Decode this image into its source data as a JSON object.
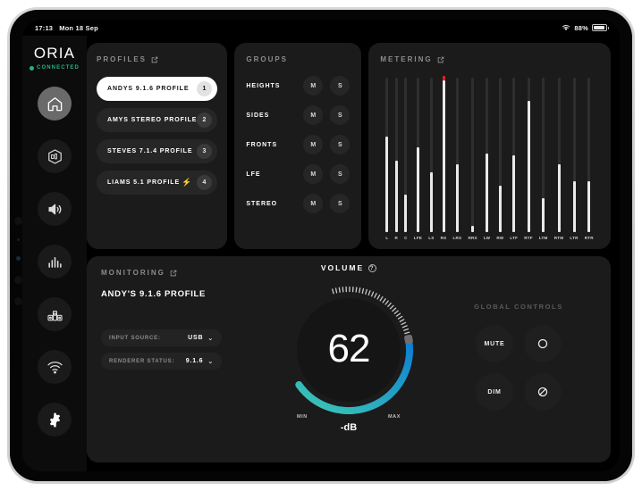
{
  "status_bar": {
    "time": "17:13",
    "date": "Mon 18 Sep",
    "battery_percent": "88%",
    "wifi_icon": "wifi-icon"
  },
  "brand": {
    "name": "ORIA",
    "connection_status": "CONNECTED",
    "status_color": "#24b47e"
  },
  "sidebar": {
    "items": [
      {
        "name": "home",
        "icon": "home-icon",
        "active": true
      },
      {
        "name": "spatial",
        "icon": "cube-icon",
        "active": false
      },
      {
        "name": "audio",
        "icon": "speaker-icon",
        "active": false
      },
      {
        "name": "levels",
        "icon": "bars-icon",
        "active": false
      },
      {
        "name": "monitors",
        "icon": "speakers-icon",
        "active": false
      },
      {
        "name": "network",
        "icon": "wifi-icon",
        "active": false
      },
      {
        "name": "settings",
        "icon": "gear-icon",
        "active": false
      }
    ]
  },
  "profiles": {
    "title": "PROFILES",
    "items": [
      {
        "label": "ANDYS 9.1.6 PROFILE",
        "badge": "1",
        "selected": true,
        "bolt": false
      },
      {
        "label": "AMYS STEREO PROFILE",
        "badge": "2",
        "selected": false,
        "bolt": false
      },
      {
        "label": "STEVES 7.1.4 PROFILE",
        "badge": "3",
        "selected": false,
        "bolt": false
      },
      {
        "label": "LIAMS 5.1 PROFILE",
        "badge": "4",
        "selected": false,
        "bolt": true
      }
    ]
  },
  "groups": {
    "title": "GROUPS",
    "mute_label": "M",
    "solo_label": "S",
    "items": [
      {
        "label": "HEIGHTS"
      },
      {
        "label": "SIDES"
      },
      {
        "label": "FRONTS"
      },
      {
        "label": "LFE"
      },
      {
        "label": "STEREO"
      }
    ]
  },
  "metering": {
    "title": "METERING"
  },
  "chart_data": {
    "type": "bar",
    "title": "METERING",
    "xlabel": "",
    "ylabel": "",
    "ylim": [
      0,
      100
    ],
    "grid": false,
    "categories": [
      "L",
      "R",
      "C",
      "LFE",
      "LS",
      "RS",
      "LRS",
      "RRS",
      "LW",
      "RW",
      "LTF",
      "RTF",
      "LTM",
      "RTM",
      "LTR",
      "RTR"
    ],
    "values": [
      62,
      46,
      24,
      55,
      39,
      98,
      44,
      4,
      51,
      30,
      50,
      85,
      22,
      44,
      33,
      33
    ],
    "peak_channel": "RS",
    "peak_color": "#e02020",
    "bar_color": "#e9e9e9",
    "track_color": "#2e2e2e"
  },
  "monitoring": {
    "title": "MONITORING",
    "profile_name": "ANDY'S 9.1.6 PROFILE",
    "fields": [
      {
        "key": "INPUT SOURCE:",
        "value": "USB"
      },
      {
        "key": "RENDERER STATUS:",
        "value": "9.1.6"
      }
    ]
  },
  "volume": {
    "title": "VOLUME",
    "value": "62",
    "unit": "-dB",
    "min_label": "MIN",
    "max_label": "MAX",
    "percent": 62,
    "arc_start_color": "#3ec8b4",
    "arc_end_color": "#0b7fd4"
  },
  "global_controls": {
    "title": "GLOBAL CONTROLS",
    "buttons": [
      {
        "label": "MUTE",
        "icon": ""
      },
      {
        "label": "",
        "icon": "circle-icon"
      },
      {
        "label": "DIM",
        "icon": ""
      },
      {
        "label": "",
        "icon": "circle-slash-icon"
      }
    ]
  }
}
